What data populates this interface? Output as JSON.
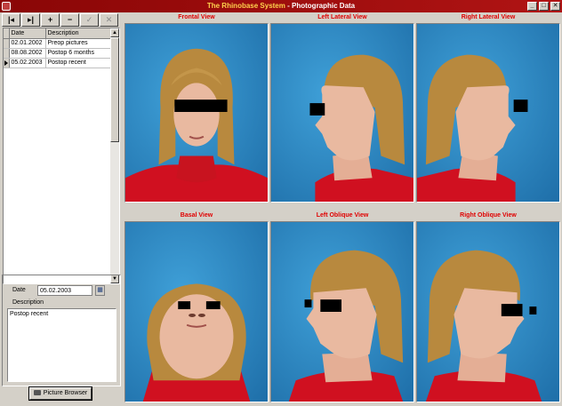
{
  "window": {
    "app_name": "The Rhinobase System",
    "separator": "-",
    "title": "Photographic Data",
    "buttons": [
      "_",
      "□",
      "✕"
    ]
  },
  "toolbar": {
    "buttons": [
      {
        "icon": "first-record-icon",
        "glyph": "|◂"
      },
      {
        "icon": "last-record-icon",
        "glyph": "▸|"
      },
      {
        "icon": "add-icon",
        "glyph": "+"
      },
      {
        "icon": "delete-icon",
        "glyph": "−"
      },
      {
        "icon": "confirm-icon",
        "glyph": "✓"
      },
      {
        "icon": "cancel-icon",
        "glyph": "✕"
      }
    ]
  },
  "grid": {
    "columns": [
      "Date",
      "Description"
    ],
    "rows": [
      {
        "date": "02.01.2002",
        "description": "Preop pictures"
      },
      {
        "date": "08.08.2002",
        "description": "Postop 6 months"
      },
      {
        "date": "05.02.2003",
        "description": "Postop recent"
      }
    ],
    "selected_row": 2
  },
  "detail": {
    "date_label": "Date",
    "date_value": "05.02.2003",
    "description_label": "Description",
    "description_value": "Postop recent"
  },
  "picture_browser_label": "Picture Browser",
  "views": [
    {
      "title": "Frontal View",
      "kind": "frontal"
    },
    {
      "title": "Left Lateral View",
      "kind": "left-lateral"
    },
    {
      "title": "Right Lateral View",
      "kind": "right-lateral"
    },
    {
      "title": "Basal View",
      "kind": "basal"
    },
    {
      "title": "Left Oblique View",
      "kind": "left-oblique"
    },
    {
      "title": "Right Oblique View",
      "kind": "right-oblique"
    }
  ],
  "colors": {
    "titlebar": "#a00e0e",
    "view_title": "#e00000",
    "photo_background": "#2a86c4",
    "sweater": "#d01020",
    "hair": "#b8893e",
    "skin": "#e9b9a0"
  }
}
